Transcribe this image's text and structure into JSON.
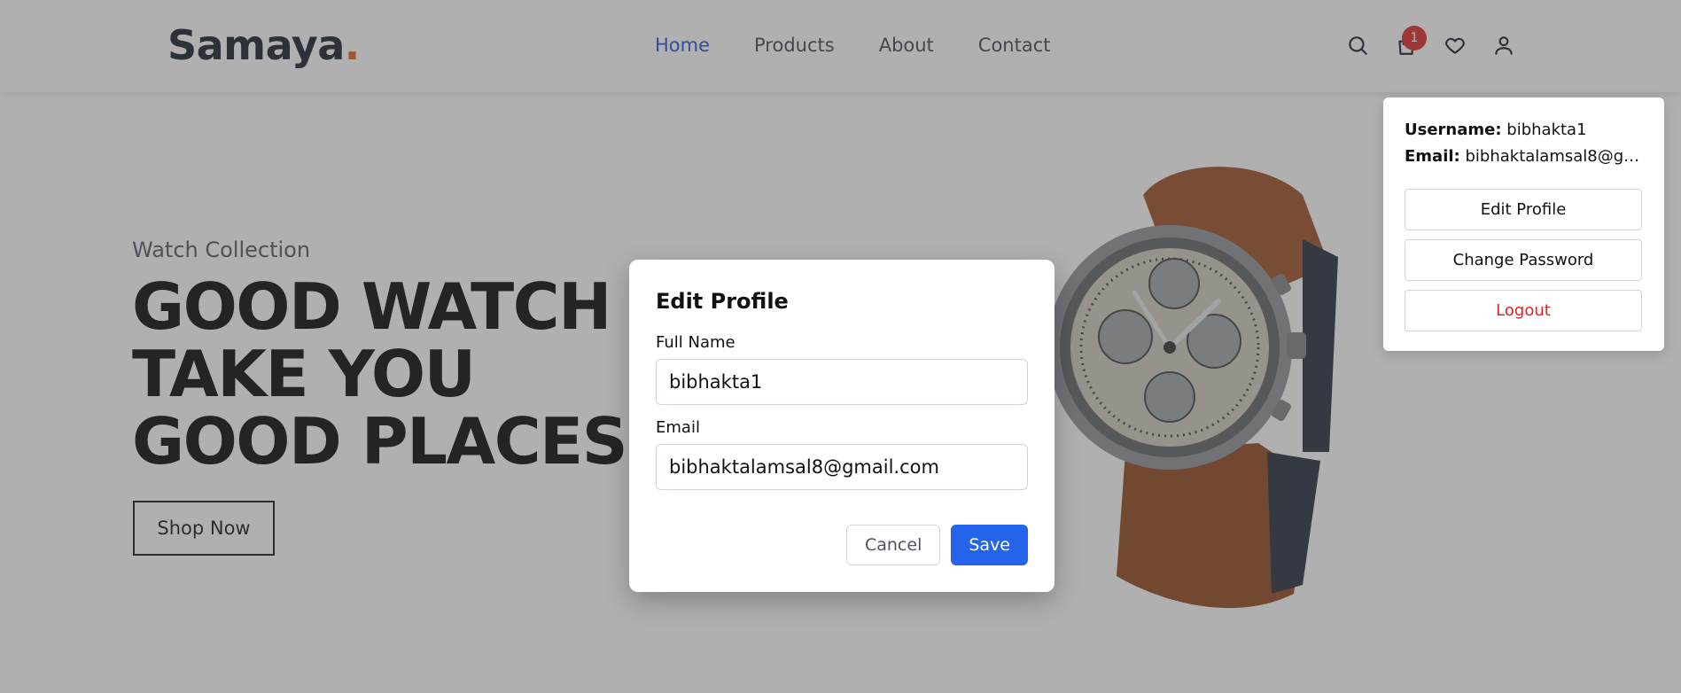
{
  "brand": {
    "name": "Samaya",
    "dot": ".",
    "accent_color": "#ea580c"
  },
  "nav": {
    "items": [
      {
        "label": "Home",
        "active": true
      },
      {
        "label": "Products",
        "active": false
      },
      {
        "label": "About",
        "active": false
      },
      {
        "label": "Contact",
        "active": false
      }
    ]
  },
  "header_icons": {
    "search": "search-icon",
    "cart": "cart-icon",
    "cart_count": "1",
    "wishlist": "heart-icon",
    "account": "user-icon"
  },
  "hero": {
    "subtitle": "Watch Collection",
    "title_lines": [
      "GOOD WATCH",
      "TAKE YOU",
      "GOOD PLACES"
    ],
    "cta_label": "Shop Now"
  },
  "account_menu": {
    "username_label": "Username:",
    "username": "bibhakta1",
    "email_label": "Email:",
    "email": "bibhaktalamsal8@gm...",
    "edit_profile_label": "Edit Profile",
    "change_password_label": "Change Password",
    "logout_label": "Logout"
  },
  "edit_profile_modal": {
    "title": "Edit Profile",
    "full_name_label": "Full Name",
    "full_name_value": "bibhakta1",
    "email_label": "Email",
    "email_value": "bibhaktalamsal8@gmail.com",
    "cancel_label": "Cancel",
    "save_label": "Save",
    "primary_color": "#2563eb"
  }
}
